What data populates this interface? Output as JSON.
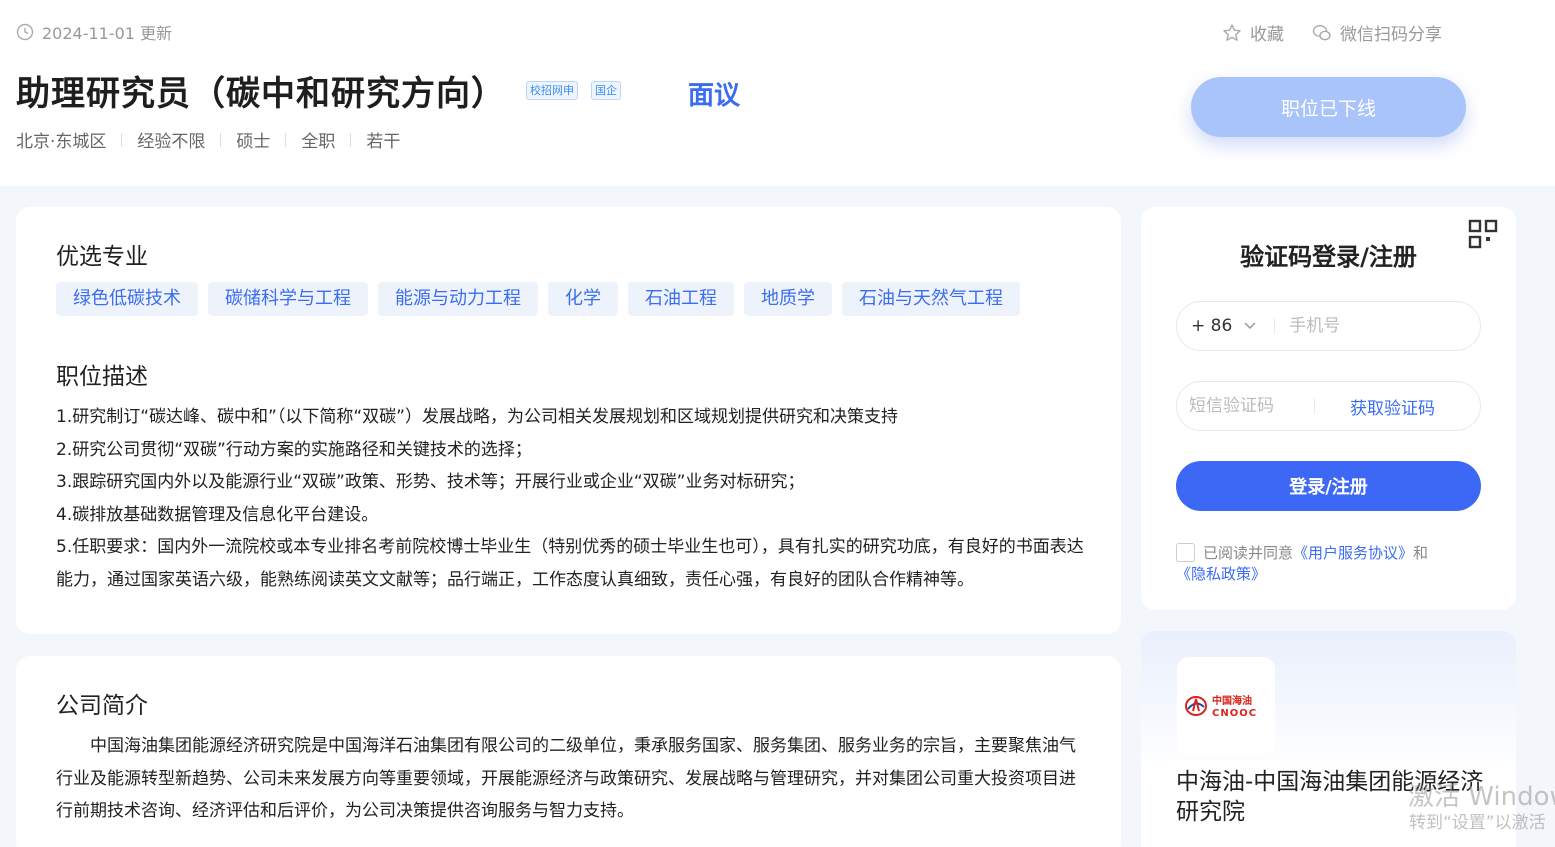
{
  "header": {
    "update_text": "2024-11-01 更新",
    "actions": {
      "collect": "收藏",
      "share": "微信扫码分享"
    },
    "job_title": "助理研究员（碳中和研究方向）",
    "tags": [
      "校招网申",
      "国企"
    ],
    "salary": "面议",
    "meta": [
      "北京·东城区",
      "经验不限",
      "硕士",
      "全职",
      "若干"
    ],
    "status_button": "职位已下线"
  },
  "main": {
    "majors_title": "优选专业",
    "majors": [
      "绿色低碳技术",
      "碳储科学与工程",
      "能源与动力工程",
      "化学",
      "石油工程",
      "地质学",
      "石油与天然气工程"
    ],
    "desc_title": "职位描述",
    "desc_lines": [
      "1.研究制订“碳达峰、碳中和”（以下简称“双碳”）发展战略，为公司相关发展规划和区域规划提供研究和决策支持",
      "2.研究公司贯彻“双碳”行动方案的实施路径和关键技术的选择；",
      "3.跟踪研究国内外以及能源行业“双碳”政策、形势、技术等；开展行业或企业“双碳”业务对标研究；",
      "4.碳排放基础数据管理及信息化平台建设。",
      "5.任职要求：国内外一流院校或本专业排名考前院校博士毕业生（特别优秀的硕士毕业生也可），具有扎实的研究功底，有良好的书面表达能力，通过国家英语六级，能熟练阅读英文文献等；品行端正，工作态度认真细致，责任心强，有良好的团队合作精神等。"
    ]
  },
  "company": {
    "title": "公司简介",
    "text": "中国海油集团能源经济研究院是中国海洋石油集团有限公司的二级单位，秉承服务国家、服务集团、服务业务的宗旨，主要聚焦油气行业及能源转型新趋势、公司未来发展方向等重要领域，开展能源经济与政策研究、发展战略与管理研究，并对集团公司重大投资项目进行前期技术咨询、经济评估和后评价，为公司决策提供咨询服务与智力支持。"
  },
  "login": {
    "title": "验证码登录/注册",
    "country_code": "+ 86",
    "phone_placeholder": "手机号",
    "sms_placeholder": "短信验证码",
    "get_code": "获取验证码",
    "submit": "登录/注册",
    "agree_prefix": "已阅读并同意",
    "agree_link1": "《用户服务协议》",
    "agree_mid": "和",
    "agree_link2": "《隐私政策》"
  },
  "side_company": {
    "logo_text_cn": "中国海油",
    "logo_text_en": "CNOOC",
    "name": "中海油-中国海油集团能源经济研究院"
  },
  "watermark": {
    "line1": "激活 Windows",
    "line2": "转到“设置”以激活"
  },
  "colors": {
    "accent": "#3d68f5",
    "disabled_button": "#a9c3fb",
    "tag_bg": "#eef3fb",
    "page_bg": "#f3f6fb",
    "cnooc_red": "#d8241c"
  }
}
